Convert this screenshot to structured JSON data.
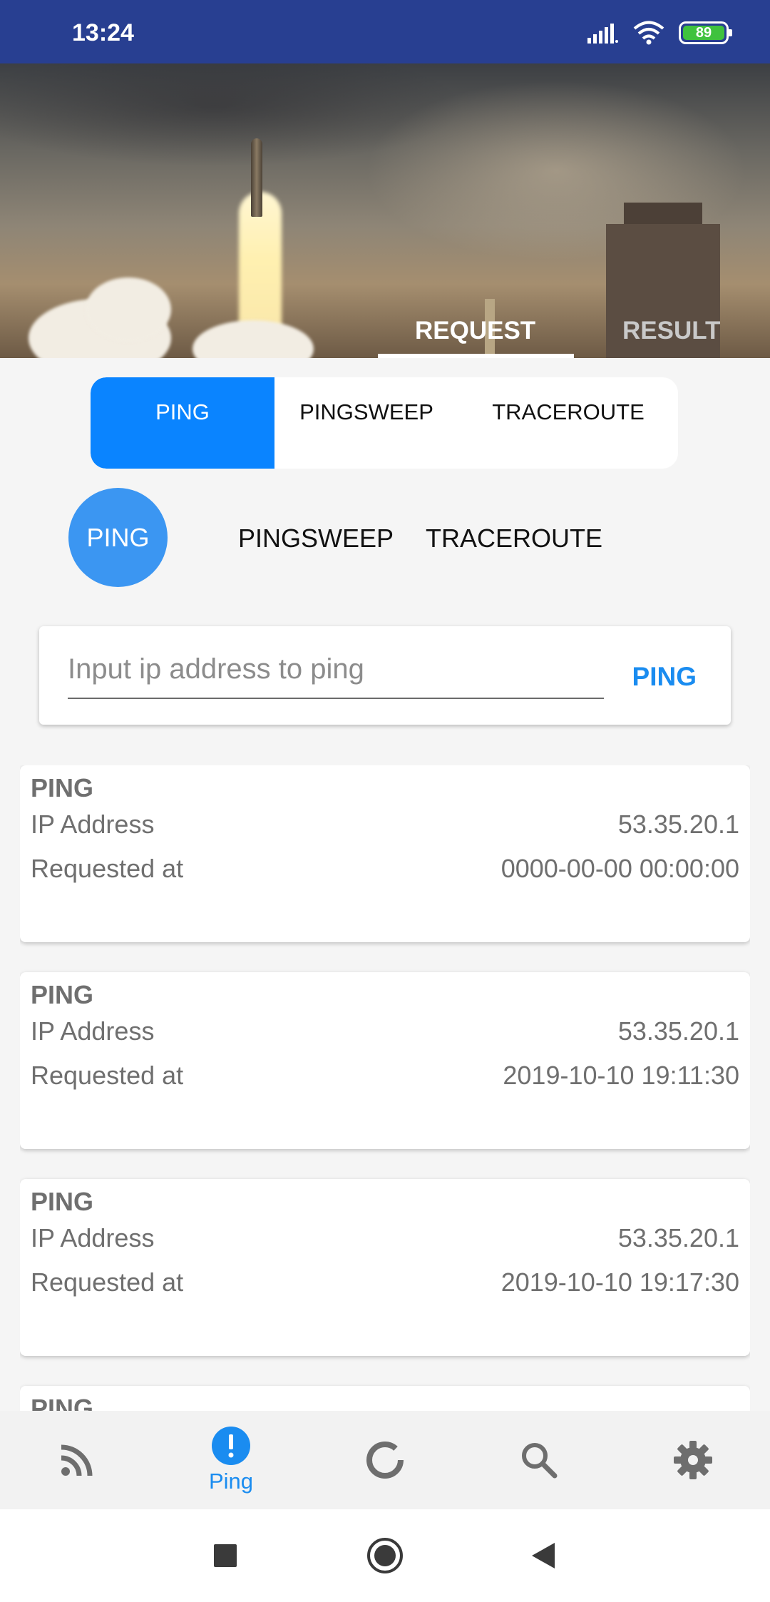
{
  "status_bar": {
    "time": "13:24",
    "battery": "89",
    "icons": [
      "signal-icon",
      "wifi-icon",
      "battery-icon"
    ]
  },
  "hero": {
    "tabs": [
      {
        "label": "REQUEST",
        "active": true
      },
      {
        "label": "RESULT",
        "active": false
      }
    ]
  },
  "segmented": {
    "items": [
      {
        "label": "PING",
        "active": true
      },
      {
        "label": "PINGSWEEP",
        "active": false
      },
      {
        "label": "TRACEROUTE",
        "active": false
      }
    ]
  },
  "round_tabs": {
    "items": [
      {
        "label": "PING",
        "active": true
      },
      {
        "label": "PINGSWEEP",
        "active": false
      },
      {
        "label": "TRACEROUTE",
        "active": false
      }
    ]
  },
  "ping_form": {
    "placeholder": "Input ip address to ping",
    "value": "",
    "button_label": "PING"
  },
  "results": [
    {
      "title": "PING",
      "ip_label": "IP Address",
      "ip": "53.35.20.1",
      "time_label": "Requested at",
      "time": "0000-00-00 00:00:00"
    },
    {
      "title": "PING",
      "ip_label": "IP Address",
      "ip": "53.35.20.1",
      "time_label": "Requested at",
      "time": "2019-10-10 19:11:30"
    },
    {
      "title": "PING",
      "ip_label": "IP Address",
      "ip": "53.35.20.1",
      "time_label": "Requested at",
      "time": "2019-10-10 19:17:30"
    },
    {
      "title": "PING",
      "ip_label": "",
      "ip": "",
      "time_label": "",
      "time": ""
    }
  ],
  "bottom_nav": {
    "items": [
      {
        "icon": "rss-icon",
        "label": "",
        "active": false
      },
      {
        "icon": "alert-icon",
        "label": "Ping",
        "active": true
      },
      {
        "icon": "loading-ring-icon",
        "label": "",
        "active": false
      },
      {
        "icon": "search-icon",
        "label": "",
        "active": false
      },
      {
        "icon": "gear-icon",
        "label": "",
        "active": false
      }
    ]
  },
  "colors": {
    "status_bar": "#283f91",
    "accent": "#0a84ff",
    "round_tab_active": "#3b96f2",
    "link": "#1a8cf0",
    "battery": "#3fc23e"
  }
}
